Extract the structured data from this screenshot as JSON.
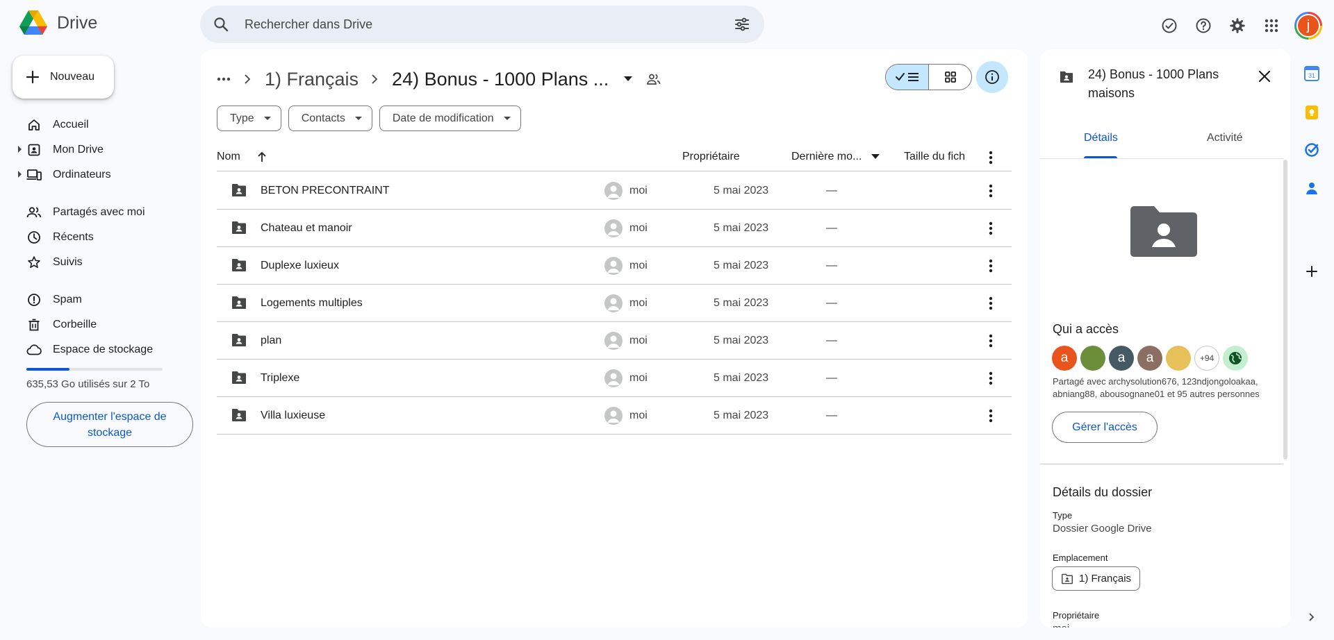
{
  "app": {
    "name": "Drive"
  },
  "search": {
    "placeholder": "Rechercher dans Drive"
  },
  "top_icons": [
    "offline-ready-icon",
    "help-icon",
    "settings-icon",
    "apps-grid-icon"
  ],
  "account": {
    "initial": "j",
    "color": "#e8541b"
  },
  "new_button": {
    "label": "Nouveau"
  },
  "nav": {
    "items": [
      {
        "label": "Accueil",
        "icon": "home-icon"
      },
      {
        "label": "Mon Drive",
        "icon": "my-drive-icon"
      },
      {
        "label": "Ordinateurs",
        "icon": "computers-icon"
      },
      {
        "label": "Partagés avec moi",
        "icon": "shared-icon"
      },
      {
        "label": "Récents",
        "icon": "recent-icon"
      },
      {
        "label": "Suivis",
        "icon": "star-icon"
      },
      {
        "label": "Spam",
        "icon": "spam-icon"
      },
      {
        "label": "Corbeille",
        "icon": "trash-icon"
      },
      {
        "label": "Espace de stockage",
        "icon": "cloud-icon"
      }
    ]
  },
  "storage": {
    "used_fraction": 0.318,
    "text": "635,53 Go utilisés sur 2 To",
    "upgrade_label": "Augmenter l'espace de stockage"
  },
  "breadcrumb": {
    "parent": "1) Français",
    "current": "24) Bonus - 1000 Plans ..."
  },
  "filters": {
    "type": "Type",
    "contacts": "Contacts",
    "modified": "Date de modification"
  },
  "table": {
    "headers": {
      "name": "Nom",
      "owner": "Propriétaire",
      "modified": "Dernière mo...",
      "size": "Taille du fich"
    },
    "rows": [
      {
        "name": "BETON PRECONTRAINT",
        "owner": "moi",
        "date": "5 mai 2023",
        "size": "—"
      },
      {
        "name": "Chateau et manoir",
        "owner": "moi",
        "date": "5 mai 2023",
        "size": "—"
      },
      {
        "name": "Duplexe luxieux",
        "owner": "moi",
        "date": "5 mai 2023",
        "size": "—"
      },
      {
        "name": "Logements multiples",
        "owner": "moi",
        "date": "5 mai 2023",
        "size": "—"
      },
      {
        "name": "plan",
        "owner": "moi",
        "date": "5 mai 2023",
        "size": "—"
      },
      {
        "name": "Triplexe",
        "owner": "moi",
        "date": "5 mai 2023",
        "size": "—"
      },
      {
        "name": "Villa luxieuse",
        "owner": "moi",
        "date": "5 mai 2023",
        "size": "—"
      }
    ]
  },
  "details": {
    "title": "24) Bonus - 1000 Plans maisons",
    "tabs": [
      "Détails",
      "Activité"
    ],
    "who_has_access": "Qui a accès",
    "avatars": [
      {
        "letter": "a",
        "color": "#e8541b"
      },
      {
        "letter": "",
        "color": "#6b8e3a"
      },
      {
        "letter": "a",
        "color": "#455a64"
      },
      {
        "letter": "a",
        "color": "#8d6e63"
      },
      {
        "letter": "",
        "color": "#e6c15a"
      }
    ],
    "more_count": "+94",
    "shared_text": "Partagé avec archysolution676, 123ndjongoloakaa, abniang88, abousognane01 et 95 autres personnes",
    "manage_label": "Gérer l'accès",
    "folder_details_title": "Détails du dossier",
    "type_label": "Type",
    "type_value": "Dossier Google Drive",
    "location_label": "Emplacement",
    "location_value": "1) Français",
    "owner_label": "Propriétaire",
    "owner_value": "moi"
  },
  "colors": {
    "accent": "#0b57d0",
    "selected": "#c2e7ff",
    "surface": "#f8fafd"
  }
}
